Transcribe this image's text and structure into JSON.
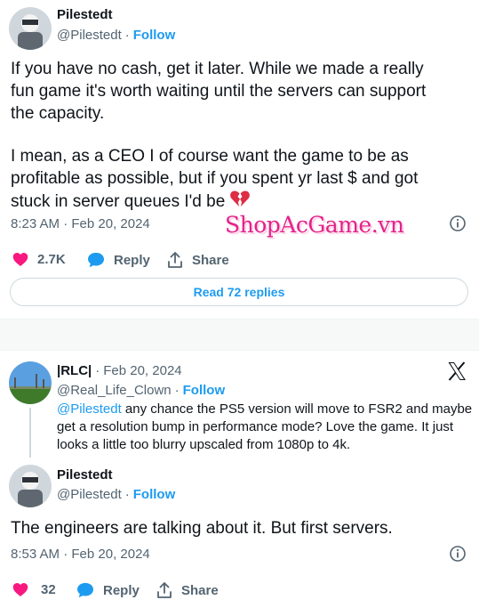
{
  "tweet1": {
    "name": "Pilestedt",
    "handle": "@Pilestedt",
    "sep": "·",
    "follow": "Follow",
    "body_lines": [
      "If you have no cash, get it later. While we made a really",
      "fun game it's worth waiting until the servers can support",
      "the capacity."
    ],
    "body_lines2": [
      "I mean, as a CEO I of course want the game to be as",
      "profitable as possible, but if you spent yr last $ and got",
      "stuck in server queues I'd be"
    ],
    "emoji": "broken-heart-icon",
    "timestamp": "8:23 AM · Feb 20, 2024",
    "likes": "2.7K",
    "reply_label": "Reply",
    "share_label": "Share",
    "read_replies": "Read 72 replies"
  },
  "watermark": "ShopAcGame.vn",
  "tweet2": {
    "name": "|RLC|",
    "date": "Feb 20, 2024",
    "sep": "·",
    "handle": "@Real_Life_Clown",
    "follow": "Follow",
    "mention": "@Pilestedt",
    "lines": [
      " any chance the PS5 version will move to FSR2 and maybe",
      "get a resolution bump in performance mode? Love the game. It just",
      "looks a little too blurry upscaled from 1080p to 4k."
    ],
    "brand_icon": "x-logo-icon"
  },
  "tweet3": {
    "name": "Pilestedt",
    "handle": "@Pilestedt",
    "sep": "·",
    "follow": "Follow",
    "body": "The engineers are talking about it. But first servers.",
    "timestamp": "8:53 AM · Feb 20, 2024",
    "likes": "32",
    "reply_label": "Reply",
    "share_label": "Share"
  },
  "colors": {
    "accent": "#1d9bf0",
    "like": "#f91880",
    "muted": "#536471",
    "watermark": "#e3228a"
  }
}
